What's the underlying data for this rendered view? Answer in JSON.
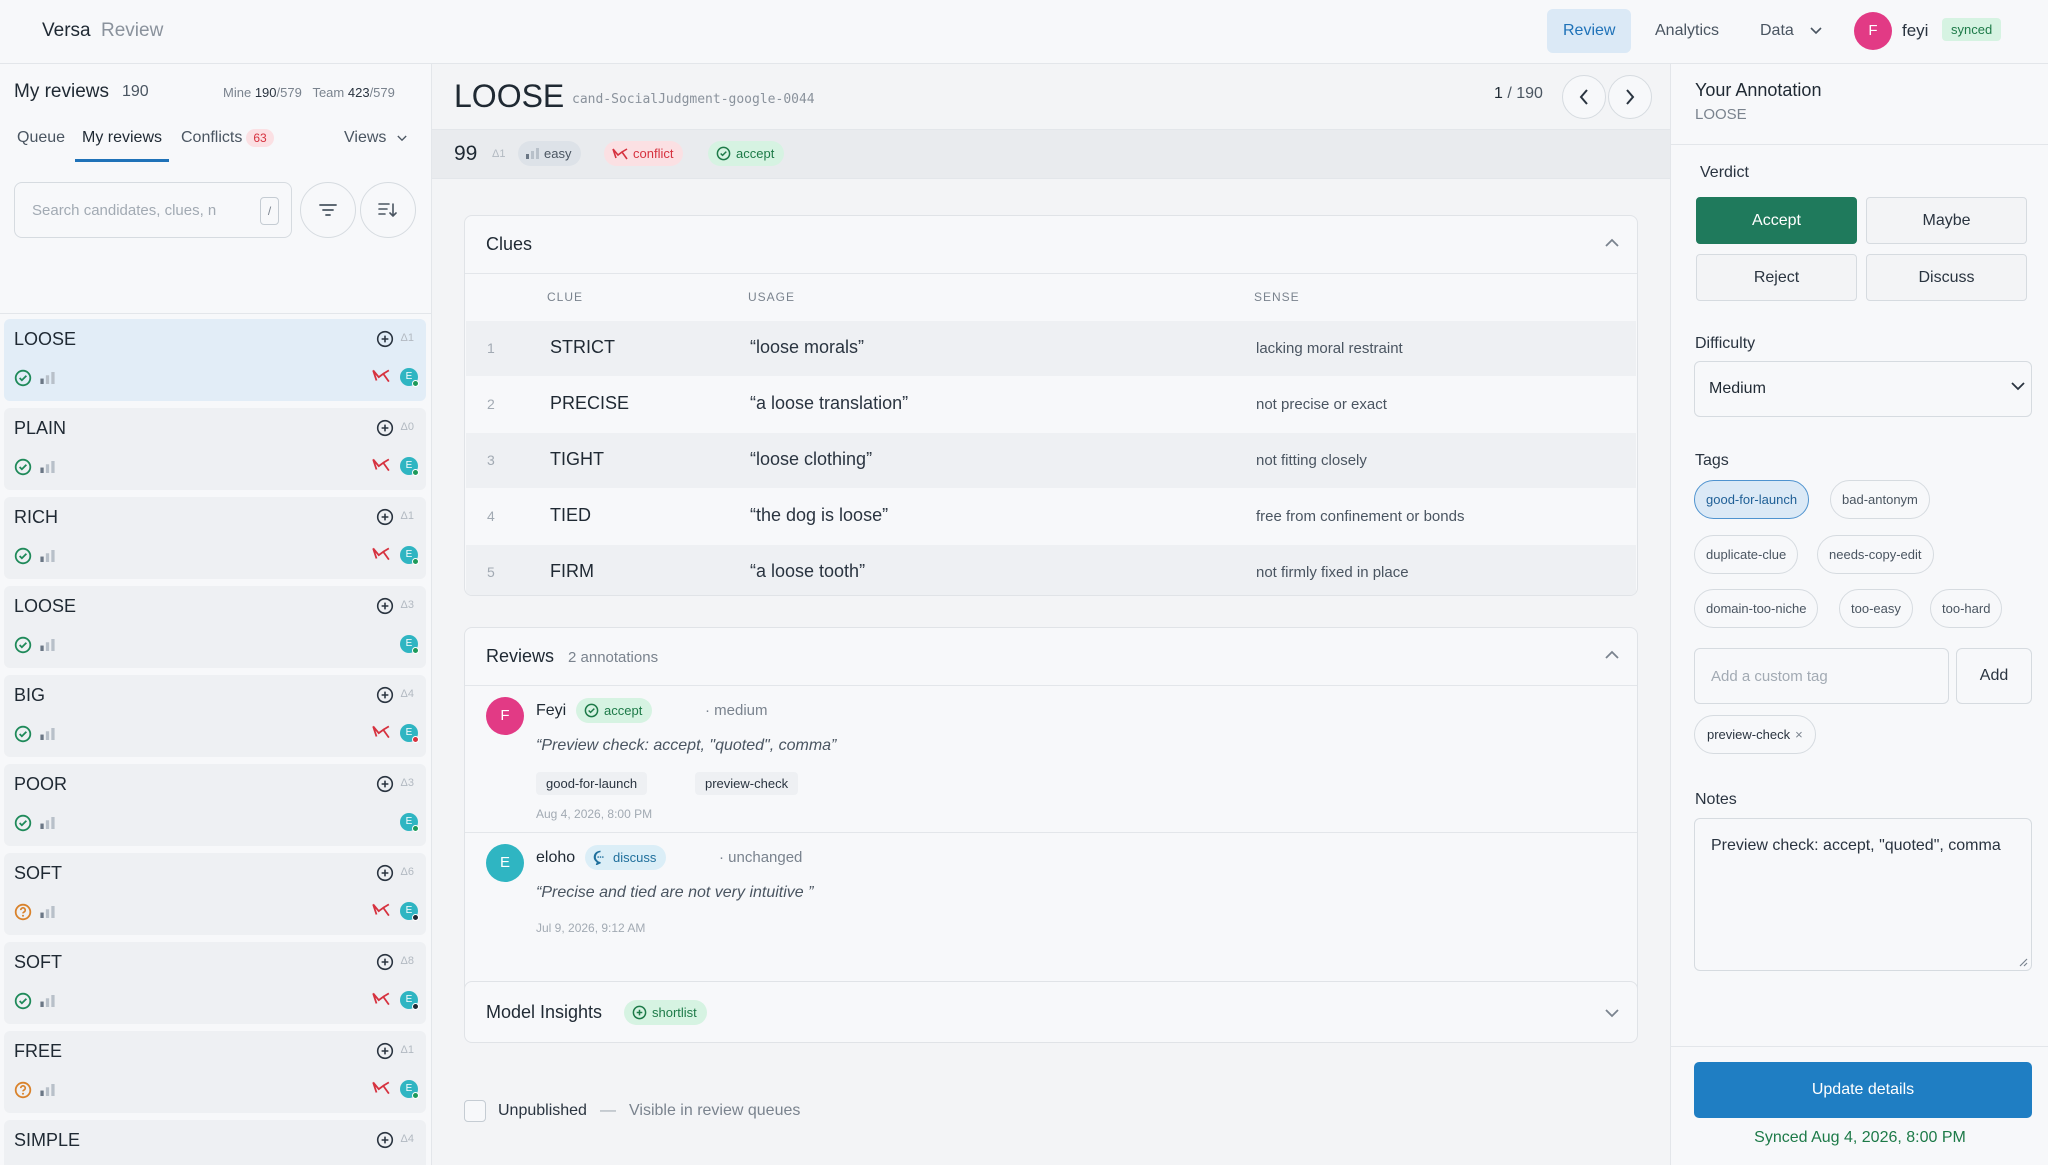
{
  "app": {
    "name": "Versa",
    "section": "Review"
  },
  "nav": {
    "review": "Review",
    "analytics": "Analytics",
    "data": "Data",
    "user_initial": "F",
    "user": "feyi",
    "sync_status": "synced"
  },
  "sidebar": {
    "title": "My reviews",
    "count": "190",
    "mine_label": "Mine",
    "mine_value": "190",
    "mine_total": "/579",
    "team_label": "Team",
    "team_value": "423",
    "team_total": "/579",
    "tabs": [
      "Queue",
      "My reviews",
      "Conflicts"
    ],
    "conflicts_count": "63",
    "views": "Views",
    "search_placeholder": "Search candidates, clues, n",
    "search_shortcut": "/",
    "items": [
      {
        "word": "LOOSE",
        "delta": "Δ1",
        "status": "accept",
        "conflict": true,
        "dot": "#1d9a5a",
        "selected": true
      },
      {
        "word": "PLAIN",
        "delta": "Δ0",
        "status": "accept",
        "conflict": true,
        "dot": "#1d9a5a"
      },
      {
        "word": "RICH",
        "delta": "Δ1",
        "status": "accept",
        "conflict": true,
        "dot": "#1d9a5a"
      },
      {
        "word": "LOOSE",
        "delta": "Δ3",
        "status": "accept",
        "conflict": false,
        "dot": "#1d9a5a"
      },
      {
        "word": "BIG",
        "delta": "Δ4",
        "status": "accept",
        "conflict": true,
        "dot": "#d6323f"
      },
      {
        "word": "POOR",
        "delta": "Δ3",
        "status": "accept",
        "conflict": false,
        "dot": "#1d9a5a"
      },
      {
        "word": "SOFT",
        "delta": "Δ6",
        "status": "maybe",
        "conflict": true,
        "dot": "#1f2933"
      },
      {
        "word": "SOFT",
        "delta": "Δ8",
        "status": "accept",
        "conflict": true,
        "dot": "#1f2933"
      },
      {
        "word": "FREE",
        "delta": "Δ1",
        "status": "maybe",
        "conflict": true,
        "dot": "#1d9a5a"
      },
      {
        "word": "SIMPLE",
        "delta": "Δ4",
        "status": "accept",
        "conflict": false,
        "dot": "#1d9a5a"
      }
    ],
    "avatar_initial": "E"
  },
  "main": {
    "word": "LOOSE",
    "candidate_id": "cand-SocialJudgment-google-0044",
    "pager_current": "1",
    "pager_total": " / 190",
    "score": "99",
    "score_delta": "Δ1",
    "difficulty_pill": "easy",
    "conflict_pill": "conflict",
    "accept_pill": "accept",
    "clues": {
      "title": "Clues",
      "headers": [
        "CLUE",
        "USAGE",
        "SENSE"
      ],
      "rows": [
        {
          "n": "1",
          "clue": "STRICT",
          "usage": "“loose morals”",
          "sense": "lacking moral restraint"
        },
        {
          "n": "2",
          "clue": "PRECISE",
          "usage": "“a loose translation”",
          "sense": "not precise or exact"
        },
        {
          "n": "3",
          "clue": "TIGHT",
          "usage": "“loose clothing”",
          "sense": "not fitting closely"
        },
        {
          "n": "4",
          "clue": "TIED",
          "usage": "“the dog is loose”",
          "sense": "free from confinement or bonds"
        },
        {
          "n": "5",
          "clue": "FIRM",
          "usage": "“a loose tooth”",
          "sense": "not firmly fixed in place"
        }
      ]
    },
    "reviews": {
      "title": "Reviews",
      "count": "2 annotations",
      "items": [
        {
          "initial": "F",
          "name": "Feyi",
          "verdict": "accept",
          "meta": "· medium",
          "quote": "“Preview check: accept, \"quoted\", comma”",
          "tags": [
            "good-for-launch",
            "preview-check"
          ],
          "date": "Aug 4, 2026, 8:00 PM"
        },
        {
          "initial": "E",
          "name": "eloho",
          "verdict": "discuss",
          "meta": "· unchanged",
          "quote": "“Precise and tied are not very intuitive ”",
          "tags": [],
          "date": "Jul 9, 2026, 9:12 AM"
        }
      ]
    },
    "insights": {
      "title": "Model Insights",
      "badge": "shortlist"
    },
    "publish": {
      "label": "Unpublished",
      "sep": "—",
      "desc": "Visible in review queues"
    }
  },
  "annotation": {
    "title": "Your Annotation",
    "word": "LOOSE",
    "verdict_label": "Verdict",
    "verdicts": [
      "Accept",
      "Maybe",
      "Reject",
      "Discuss"
    ],
    "selected_verdict": "Accept",
    "difficulty_label": "Difficulty",
    "difficulty": "Medium",
    "tags_label": "Tags",
    "tags": [
      "good-for-launch",
      "bad-antonym",
      "duplicate-clue",
      "needs-copy-edit",
      "domain-too-niche",
      "too-easy",
      "too-hard"
    ],
    "selected_tag": "good-for-launch",
    "custom_tag_placeholder": "Add a custom tag",
    "add_label": "Add",
    "custom_chip": "preview-check",
    "chip_remove": "×",
    "notes_label": "Notes",
    "notes": "Preview check: accept, \"quoted\", comma",
    "update_label": "Update details",
    "synced_text": "Synced Aug 4, 2026, 8:00 PM"
  },
  "colors": {
    "accent": "#1f72b8",
    "accept": "#1f7a5c",
    "conflict": "#d6323f",
    "avatar_f": "#e23a85",
    "avatar_e": "#2fb5c2"
  }
}
